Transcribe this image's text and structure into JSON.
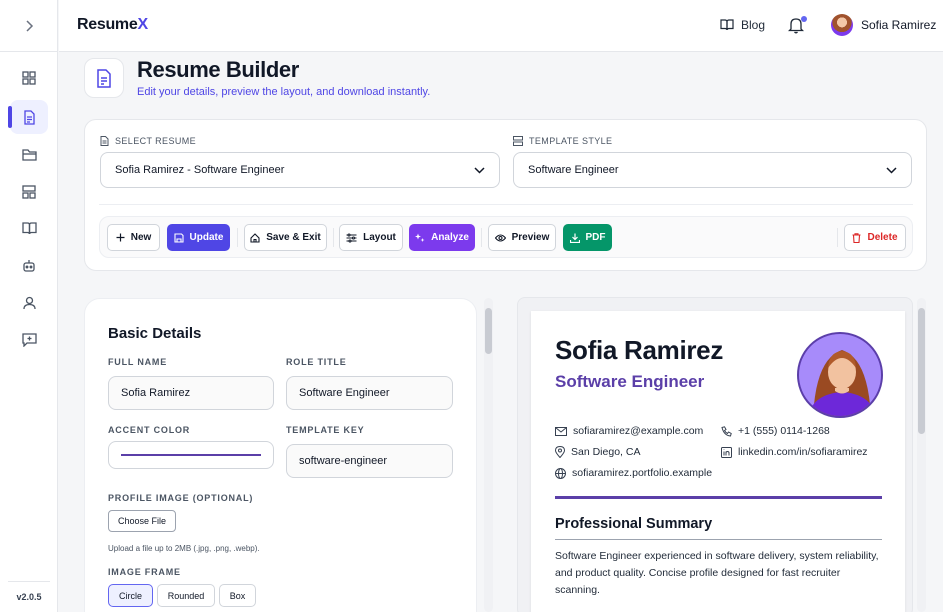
{
  "app": {
    "logo_main": "Resume",
    "logo_accent": "X",
    "version": "v2.0.5",
    "accent_color": "#4f46e5"
  },
  "topbar": {
    "blog_label": "Blog",
    "user_name": "Sofia Ramirez",
    "notification_indicator": true
  },
  "sidebar": {
    "items": [
      {
        "icon": "grid-icon",
        "active": false
      },
      {
        "icon": "document-icon",
        "active": true
      },
      {
        "icon": "folder-icon",
        "active": false
      },
      {
        "icon": "layout-icon",
        "active": false
      },
      {
        "icon": "book-icon",
        "active": false
      },
      {
        "icon": "robot-icon",
        "active": false
      },
      {
        "icon": "user-icon",
        "active": false
      },
      {
        "icon": "feedback-icon",
        "active": false
      }
    ]
  },
  "header": {
    "title": "Resume Builder",
    "subtitle": "Edit your details, preview the layout, and download instantly."
  },
  "selectors": {
    "resume_label": "SELECT RESUME",
    "resume_value": "Sofia Ramirez - Software Engineer",
    "template_label": "TEMPLATE STYLE",
    "template_value": "Software Engineer"
  },
  "toolbar": {
    "new": "New",
    "update": "Update",
    "save_exit": "Save & Exit",
    "layout": "Layout",
    "analyze": "Analyze",
    "preview": "Preview",
    "pdf": "PDF",
    "delete": "Delete"
  },
  "form": {
    "section_title": "Basic Details",
    "full_name_label": "FULL NAME",
    "full_name_value": "Sofia Ramirez",
    "role_title_label": "ROLE TITLE",
    "role_title_value": "Software Engineer",
    "accent_color_label": "ACCENT COLOR",
    "accent_color_value": "#5b3fa8",
    "template_key_label": "TEMPLATE KEY",
    "template_key_value": "software-engineer",
    "profile_image_label": "PROFILE IMAGE (OPTIONAL)",
    "choose_file": "Choose File",
    "upload_hint": "Upload a file up to 2MB (.jpg, .png, .webp).",
    "image_frame_label": "IMAGE FRAME",
    "frames": [
      "Circle",
      "Rounded",
      "Box"
    ],
    "selected_frame": "Circle"
  },
  "preview": {
    "name": "Sofia Ramirez",
    "role": "Software Engineer",
    "email": "sofiaramirez@example.com",
    "phone": "+1 (555) 0114-1268",
    "location": "San Diego, CA",
    "linkedin": "linkedin.com/in/sofiaramirez",
    "website": "sofiaramirez.portfolio.example",
    "summary_title": "Professional Summary",
    "summary": "Software Engineer experienced in software delivery, system reliability, and product quality. Concise profile designed for fast recruiter scanning."
  }
}
